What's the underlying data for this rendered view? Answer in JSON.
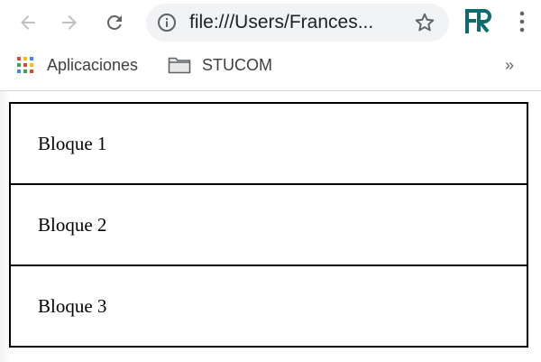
{
  "browser": {
    "url": "file:///Users/Frances...",
    "icons": {
      "back": "arrow-left-icon",
      "forward": "arrow-right-icon",
      "reload": "reload-icon",
      "info": "info-icon",
      "bookmark_star": "star-icon",
      "extension": "fr-extension-icon",
      "menu": "kebab-menu-icon"
    },
    "colors": {
      "omnibox_bg": "#f1f3f4",
      "extension_teal": "#0d6b6e",
      "icon_gray": "#5f6368",
      "icon_disabled": "#bdc1c6"
    },
    "bookmarks": [
      {
        "label": "Aplicaciones",
        "icon": "apps-grid-icon"
      },
      {
        "label": "STUCOM",
        "icon": "folder-icon"
      }
    ],
    "overflow_label": "»"
  },
  "page": {
    "blocks": [
      {
        "label": "Bloque 1"
      },
      {
        "label": "Bloque 2"
      },
      {
        "label": "Bloque 3"
      }
    ]
  }
}
